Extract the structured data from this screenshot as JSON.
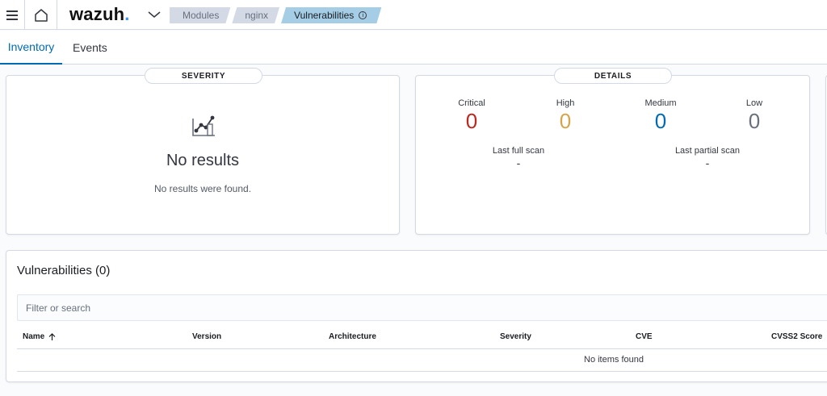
{
  "header": {
    "brand": "wazuh",
    "brand_dot": ".",
    "breadcrumbs": [
      {
        "label": "Modules"
      },
      {
        "label": "nginx"
      },
      {
        "label": "Vulnerabilities",
        "icon": "info-icon"
      }
    ],
    "info_glyph": "i"
  },
  "tabs": [
    {
      "label": "Inventory",
      "active": true
    },
    {
      "label": "Events",
      "active": false
    }
  ],
  "severity_panel": {
    "title": "SEVERITY",
    "icon": "chart-icon",
    "empty_title": "No results",
    "empty_message": "No results were found."
  },
  "details_panel": {
    "title": "DETAILS",
    "stats": [
      {
        "label": "Critical",
        "value": "0",
        "color": "#bd271e"
      },
      {
        "label": "High",
        "value": "0",
        "color": "#d6a44b"
      },
      {
        "label": "Medium",
        "value": "0",
        "color": "#006bb4"
      },
      {
        "label": "Low",
        "value": "0",
        "color": "#6a717d"
      }
    ],
    "scans": [
      {
        "label": "Last full scan",
        "value": "-"
      },
      {
        "label": "Last partial scan",
        "value": "-"
      }
    ]
  },
  "vulnerabilities": {
    "title": "Vulnerabilities (0)",
    "search_placeholder": "Filter or search",
    "columns": [
      "Name",
      "Version",
      "Architecture",
      "Severity",
      "CVE",
      "CVSS2 Score"
    ],
    "sorted_column_icon": "arrow-up-icon",
    "empty_message": "No items found"
  },
  "colors": {
    "accent": "#006bb4",
    "brand_dot": "#3595f9",
    "breadcrumb_active": "#a5cde5",
    "breadcrumb": "#d3dae6"
  }
}
